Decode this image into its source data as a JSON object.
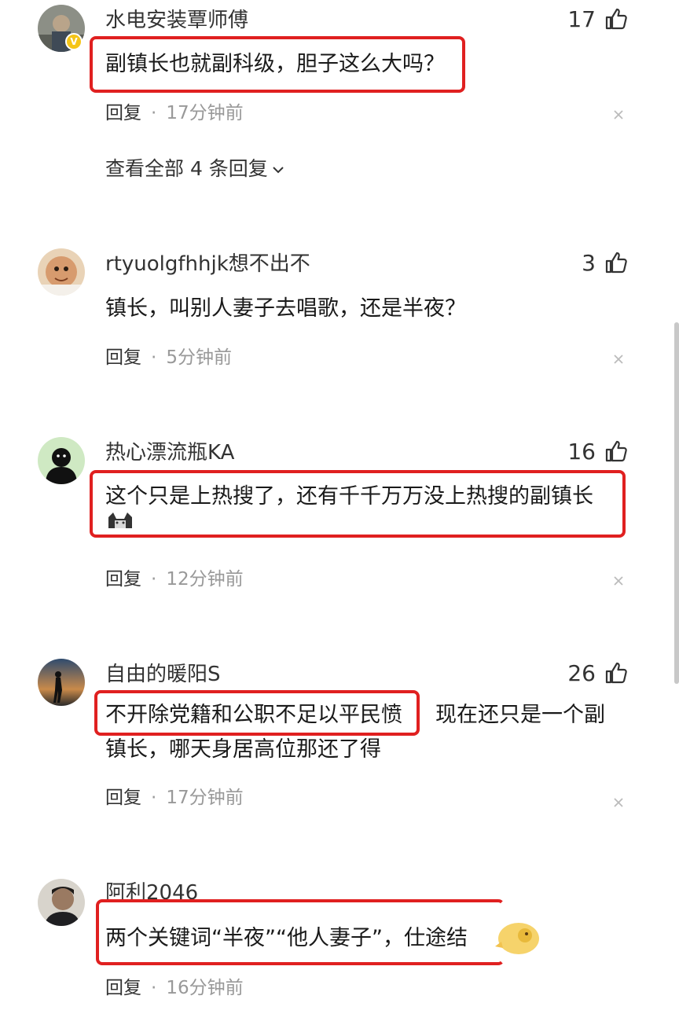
{
  "comments": [
    {
      "username": "水电安装覃师傅",
      "likes": "17",
      "text": "副镇长也就副科级，胆子这么大吗？",
      "reply_label": "回复",
      "time": "17分钟前",
      "verified": "V",
      "avatar": "man-photo-avatar"
    },
    {
      "username": "rtyuolgfhhjk想不出不",
      "likes": "3",
      "text": "镇长，叫别人妻子去唱歌，还是半夜？",
      "reply_label": "回复",
      "time": "5分钟前",
      "avatar": "baby-photo-avatar"
    },
    {
      "username": "热心漂流瓶KA",
      "likes": "16",
      "text": "这个只是上热搜了，还有千千万万没上热搜的副镇长",
      "reply_label": "回复",
      "time": "12分钟前",
      "avatar": "black-figure-avatar",
      "emoji": "cat-emoji"
    },
    {
      "username": "自由的暖阳S",
      "likes": "26",
      "text_highlight": "不开除党籍和公职不足以平民愤",
      "text_rest_line1": "现在还只是一个副",
      "text_line2": "镇长，哪天身居高位那还了得",
      "reply_label": "回复",
      "time": "17分钟前",
      "avatar": "sunset-silhouette-avatar"
    },
    {
      "username": "阿利2046",
      "text": "两个关键词“半夜”“他人妻子”，仕途结",
      "reply_label": "回复",
      "time": "16分钟前",
      "avatar": "man-dark-avatar",
      "sticker": "yellow-sticker"
    }
  ],
  "view_all_replies": "查看全部 4 条回复",
  "colors": {
    "highlight_border": "#e02020",
    "meta_gray": "#999999",
    "text": "#1a1a1a"
  }
}
